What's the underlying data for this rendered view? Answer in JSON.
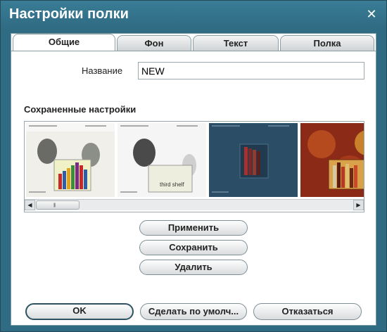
{
  "window": {
    "title": "Настройки полки",
    "close_glyph": "✕"
  },
  "tabs": [
    {
      "label": "Общие",
      "active": true
    },
    {
      "label": "Фон",
      "active": false
    },
    {
      "label": "Текст",
      "active": false
    },
    {
      "label": "Полка",
      "active": false
    }
  ],
  "name_field": {
    "label": "Название",
    "value": "NEW"
  },
  "saved_settings": {
    "title": "Сохраненные настройки",
    "thumbnails": [
      {
        "caption": ""
      },
      {
        "caption": "third shelf"
      },
      {
        "caption": ""
      },
      {
        "caption": ""
      }
    ]
  },
  "scrollbar": {
    "left_arrow": "◀",
    "right_arrow": "▶",
    "grip": "||||"
  },
  "actions": {
    "apply": "Применить",
    "save": "Сохранить",
    "delete": "Удалить"
  },
  "footer": {
    "ok": "OK",
    "default": "Сделать по умолч...",
    "cancel": "Отказаться"
  },
  "colors": {
    "frame": "#2f6c84",
    "panel": "#ffffff",
    "accent": "#2d5362"
  }
}
